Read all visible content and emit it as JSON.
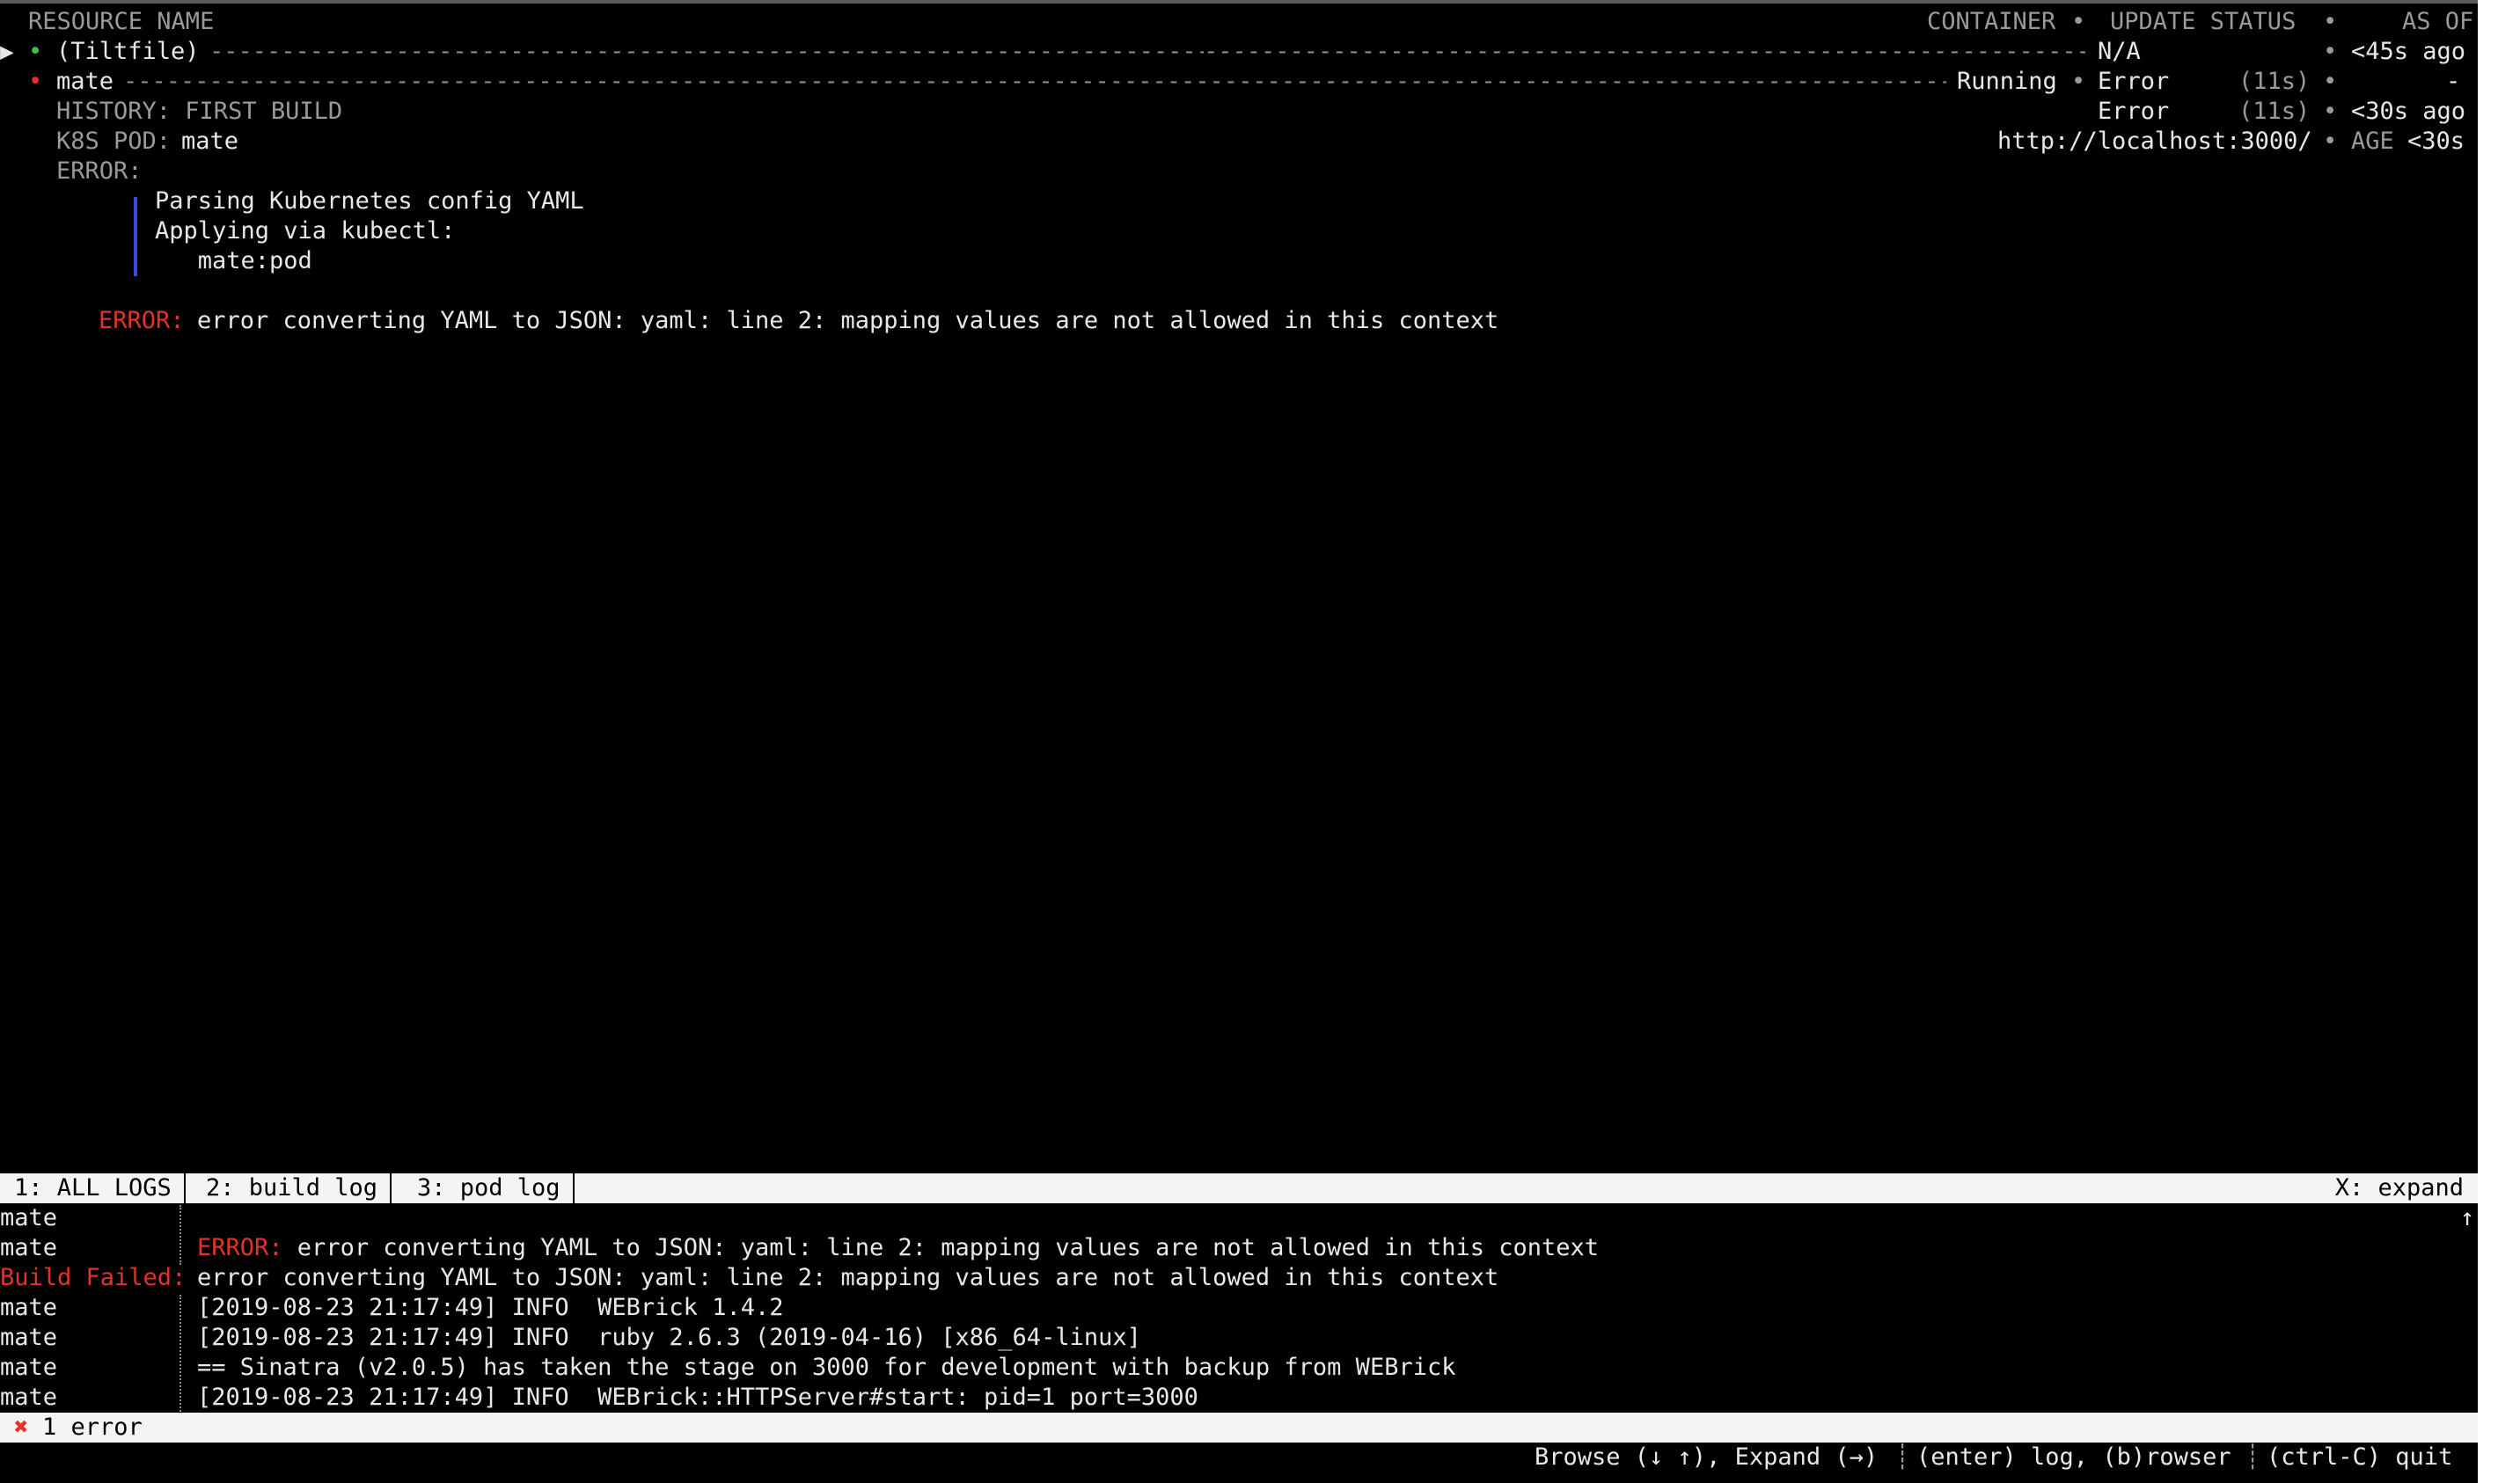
{
  "header": {
    "resource_name": "RESOURCE NAME",
    "container": "CONTAINER",
    "update_status": "UPDATE STATUS",
    "as_of": "AS OF",
    "bullet": "•"
  },
  "resources": [
    {
      "name": "(Tiltfile)",
      "container": "",
      "status": "N/A",
      "duration": "",
      "as_of": "<45s ago"
    },
    {
      "name": "mate",
      "container": "Running",
      "status": "Error",
      "duration": "(11s)",
      "as_of": "-"
    }
  ],
  "details": {
    "history_label": "HISTORY: FIRST BUILD",
    "history_status": "Error",
    "history_duration": "(11s)",
    "history_as_of": "<30s ago",
    "pod_label": "K8S POD:",
    "pod_name": "mate",
    "pod_url": "http://localhost:3000/",
    "age_label": "AGE",
    "age_value": "<30s",
    "error_label": "ERROR:",
    "error_lines": [
      "Parsing Kubernetes config YAML",
      "Applying via kubectl:",
      "   mate:pod"
    ],
    "error_prefix": "ERROR:",
    "error_message": "error converting YAML to JSON: yaml: line 2: mapping values are not allowed in this context"
  },
  "log_tabs": {
    "tab1": "1: ALL LOGS",
    "tab2": "2: build log",
    "tab3": "3: pod log",
    "expand": "X: expand",
    "scroll_icon": "↑"
  },
  "log_lines": [
    {
      "source": "mate",
      "prefix": "",
      "text": ""
    },
    {
      "source": "mate",
      "prefix": "ERROR:",
      "text": " error converting YAML to JSON: yaml: line 2: mapping values are not allowed in this context"
    },
    {
      "source": "Build Failed:",
      "prefix": "",
      "text": "error converting YAML to JSON: yaml: line 2: mapping values are not allowed in this context"
    },
    {
      "source": "mate",
      "prefix": "",
      "text": "[2019-08-23 21:17:49] INFO  WEBrick 1.4.2"
    },
    {
      "source": "mate",
      "prefix": "",
      "text": "[2019-08-23 21:17:49] INFO  ruby 2.6.3 (2019-04-16) [x86_64-linux]"
    },
    {
      "source": "mate",
      "prefix": "",
      "text": "== Sinatra (v2.0.5) has taken the stage on 3000 for development with backup from WEBrick"
    },
    {
      "source": "mate",
      "prefix": "",
      "text": "[2019-08-23 21:17:49] INFO  WEBrick::HTTPServer#start: pid=1 port=3000"
    }
  ],
  "status_bar": {
    "error_icon": "✖",
    "error_count": "1 error"
  },
  "footer": {
    "browse": "Browse (↓ ↑), Expand (→)",
    "log": "(enter) log, (b)rowser",
    "quit": "(ctrl-C) quit"
  },
  "colors": {
    "error": "#e0332b",
    "ok": "#3fbf4a",
    "tab_bar": "#f4f4f4"
  }
}
